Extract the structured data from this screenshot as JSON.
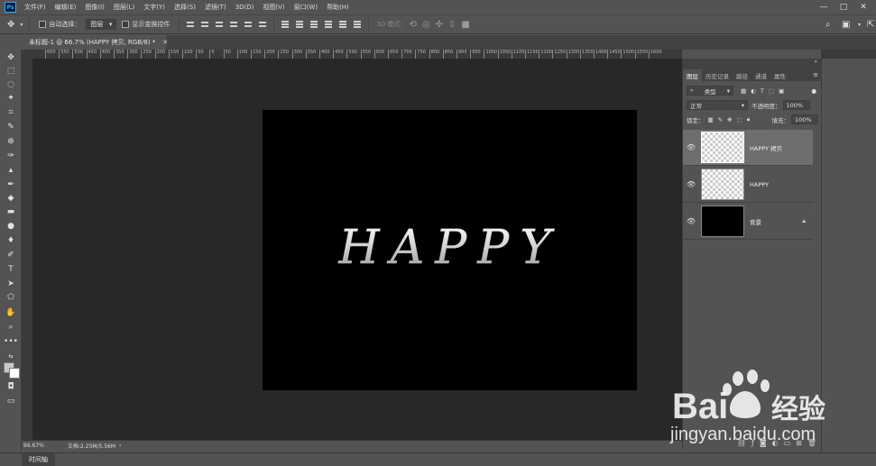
{
  "app": {
    "logo": "Ps"
  },
  "menu": [
    "文件(F)",
    "编辑(E)",
    "图像(I)",
    "图层(L)",
    "文字(Y)",
    "选择(S)",
    "滤镜(T)",
    "3D(D)",
    "视图(V)",
    "窗口(W)",
    "帮助(H)"
  ],
  "window_controls": [
    "—",
    "□",
    "✕"
  ],
  "options": {
    "auto_select_label": "自动选择：",
    "auto_select_value": "图层",
    "show_transform_label": "显示变换控件",
    "mode_3d_label": "3D 模式："
  },
  "document_tab": {
    "title": "未标题-1 @ 66.7% (HAPPY 拷贝, RGB/8) *",
    "close": "✕"
  },
  "ruler_ticks": [
    "600",
    "550",
    "500",
    "450",
    "400",
    "350",
    "300",
    "250",
    "200",
    "150",
    "100",
    "50",
    "0",
    "50",
    "100",
    "150",
    "200",
    "250",
    "300",
    "350",
    "400",
    "450",
    "500",
    "550",
    "600",
    "650",
    "700",
    "750",
    "800",
    "850",
    "900",
    "950",
    "1000",
    "1050",
    "1100",
    "1150",
    "1200",
    "1250",
    "1300",
    "1350",
    "1400",
    "1450",
    "1500",
    "1550",
    "1600"
  ],
  "canvas_text": "HAPPY",
  "status": {
    "zoom": "66.67%",
    "doc_info": "文档:2.25M/5.56M"
  },
  "timeline_tab": "时间轴",
  "layers_panel": {
    "tabs": [
      "图层",
      "历史记录",
      "路径",
      "通道",
      "属性"
    ],
    "filter_kind": "类型",
    "blend_mode": "正常",
    "opacity_label": "不透明度：",
    "opacity_value": "100%",
    "lock_label": "锁定：",
    "fill_label": "填充：",
    "fill_value": "100%",
    "layers": [
      {
        "name": "HAPPY 拷贝",
        "selected": true,
        "thumb": "transparent"
      },
      {
        "name": "HAPPY",
        "selected": false,
        "thumb": "transparent"
      },
      {
        "name": "背景",
        "selected": false,
        "thumb": "black",
        "locked": true
      }
    ]
  },
  "watermark": {
    "brand": "Bai",
    "brand2": "经验",
    "url": "jingyan.baidu.com"
  }
}
